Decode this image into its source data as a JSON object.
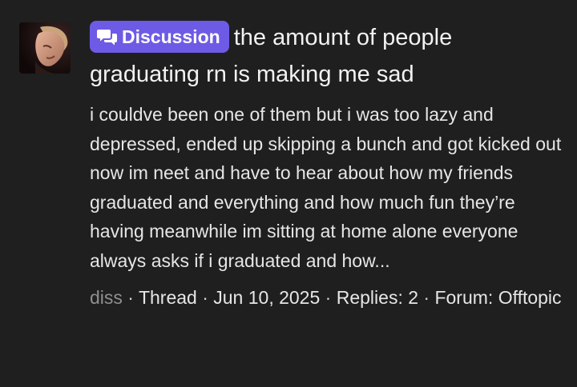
{
  "post": {
    "avatar_icon": "user-avatar-photo",
    "badge": {
      "icon": "speech-bubbles-icon",
      "label": "Discussion",
      "color": "#6d5be6"
    },
    "title": "the amount of people graduating rn is making me sad",
    "snippet": "i couldve been one of them but i was too lazy and depressed, ended up skipping a bunch and got kicked out now im neet and have to hear about how my friends graduated and everything and how much fun they’re having meanwhile im sitting at home alone everyone always asks if i graduated and how...",
    "meta": {
      "author": "diss",
      "type": "Thread",
      "date": "Jun 10, 2025",
      "replies": "Replies: 2",
      "forum": "Forum: Offtopic",
      "separator": " · "
    }
  }
}
